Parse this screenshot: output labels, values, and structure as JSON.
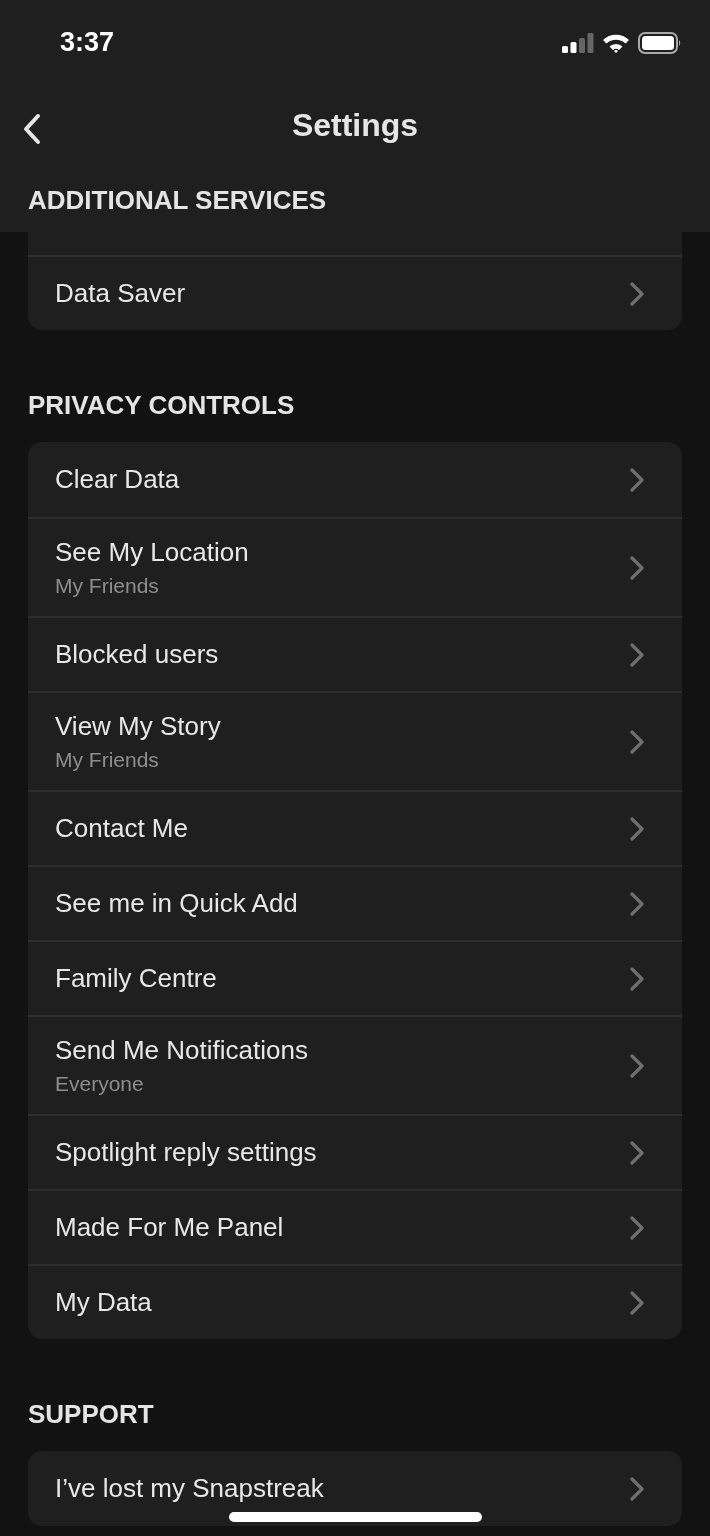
{
  "status_bar": {
    "time": "3:37"
  },
  "nav": {
    "title": "Settings"
  },
  "sections": [
    {
      "heading": "ADDITIONAL SERVICES",
      "clipped_top": true,
      "items": [
        {
          "label": "Data Saver"
        }
      ]
    },
    {
      "heading": "PRIVACY CONTROLS",
      "items": [
        {
          "label": "Clear Data"
        },
        {
          "label": "See My Location",
          "subtitle": "My Friends"
        },
        {
          "label": "Blocked users"
        },
        {
          "label": "View My Story",
          "subtitle": "My Friends"
        },
        {
          "label": "Contact Me"
        },
        {
          "label": "See me in Quick Add"
        },
        {
          "label": "Family Centre"
        },
        {
          "label": "Send Me Notifications",
          "subtitle": "Everyone"
        },
        {
          "label": "Spotlight reply settings"
        },
        {
          "label": "Made For Me Panel"
        },
        {
          "label": "My Data"
        }
      ]
    },
    {
      "heading": "SUPPORT",
      "items": [
        {
          "label": "I’ve lost my Snapstreak"
        }
      ]
    }
  ]
}
